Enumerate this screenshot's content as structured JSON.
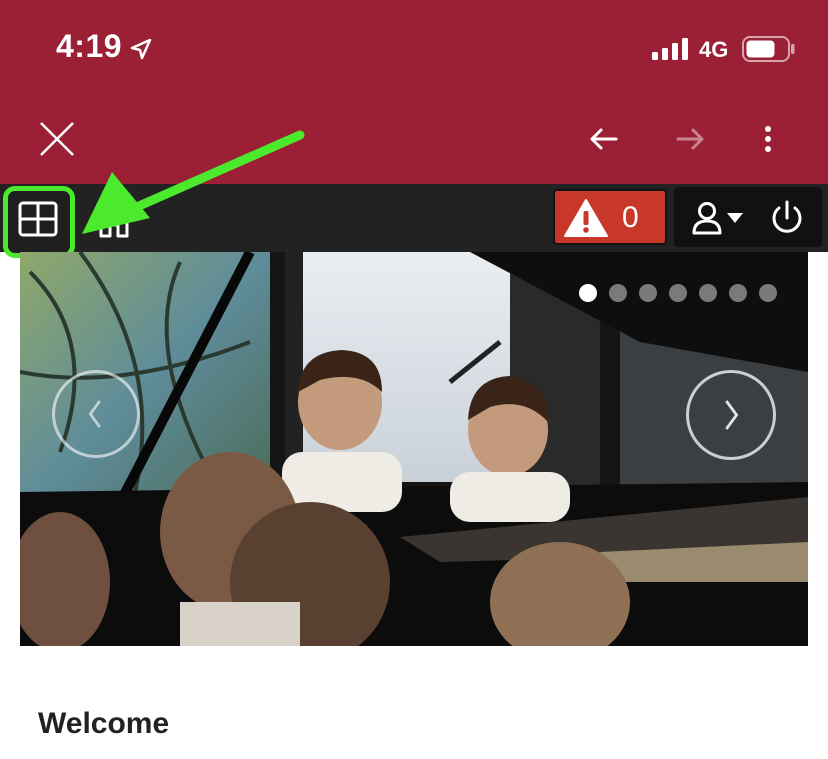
{
  "status_bar": {
    "time": "4:19",
    "network": "4G"
  },
  "browser": {
    "close_icon": "close-icon",
    "back_icon": "arrow-left-icon",
    "forward_icon": "arrow-right-icon",
    "menu_icon": "more-vertical-icon"
  },
  "toolbar": {
    "grid_icon": "grid-icon",
    "home_icon": "home-icon",
    "alert_count": "0",
    "alert_color": "#c8382a",
    "highlight_color": "#4bea2c"
  },
  "carousel": {
    "slide_count": 7,
    "active_slide": 1
  },
  "main": {
    "heading": "Welcome"
  },
  "colors": {
    "brand": "#9b1f35",
    "toolbar": "#222222"
  }
}
